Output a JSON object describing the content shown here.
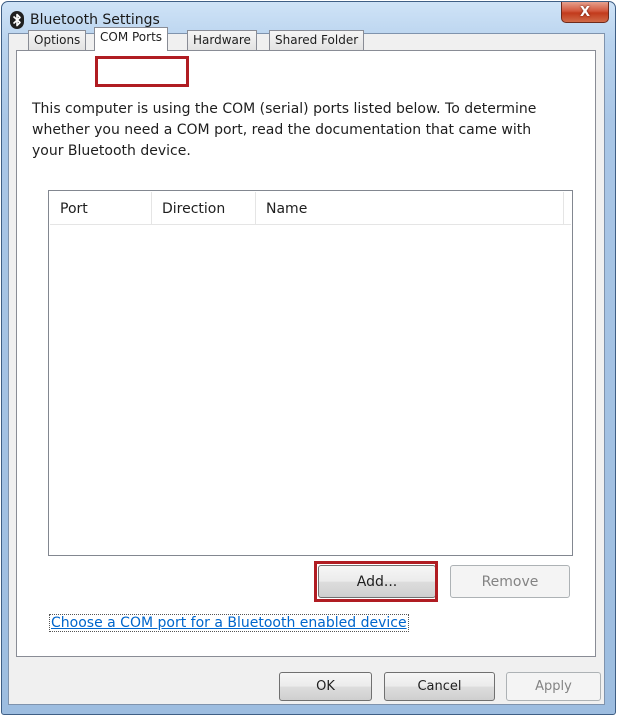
{
  "window": {
    "title": "Bluetooth Settings",
    "close_symbol": "X"
  },
  "tabs": [
    {
      "label": "Options",
      "active": false
    },
    {
      "label": "COM Ports",
      "active": true
    },
    {
      "label": "Hardware",
      "active": false
    },
    {
      "label": "Shared Folder",
      "active": false
    }
  ],
  "description": "This computer is using the COM (serial) ports listed below. To determine whether you need a COM port, read the documentation that came with your Bluetooth device.",
  "list": {
    "columns": [
      "Port",
      "Direction",
      "Name"
    ],
    "rows": []
  },
  "buttons": {
    "add": "Add...",
    "remove": "Remove",
    "ok": "OK",
    "cancel": "Cancel",
    "apply": "Apply"
  },
  "link": "Choose a COM port for a Bluetooth enabled device",
  "colors": {
    "highlight": "#b01c22",
    "link": "#0066cc",
    "close_button": "#c23a1c"
  },
  "icons": {
    "app": "bluetooth-icon",
    "close": "close-icon"
  }
}
